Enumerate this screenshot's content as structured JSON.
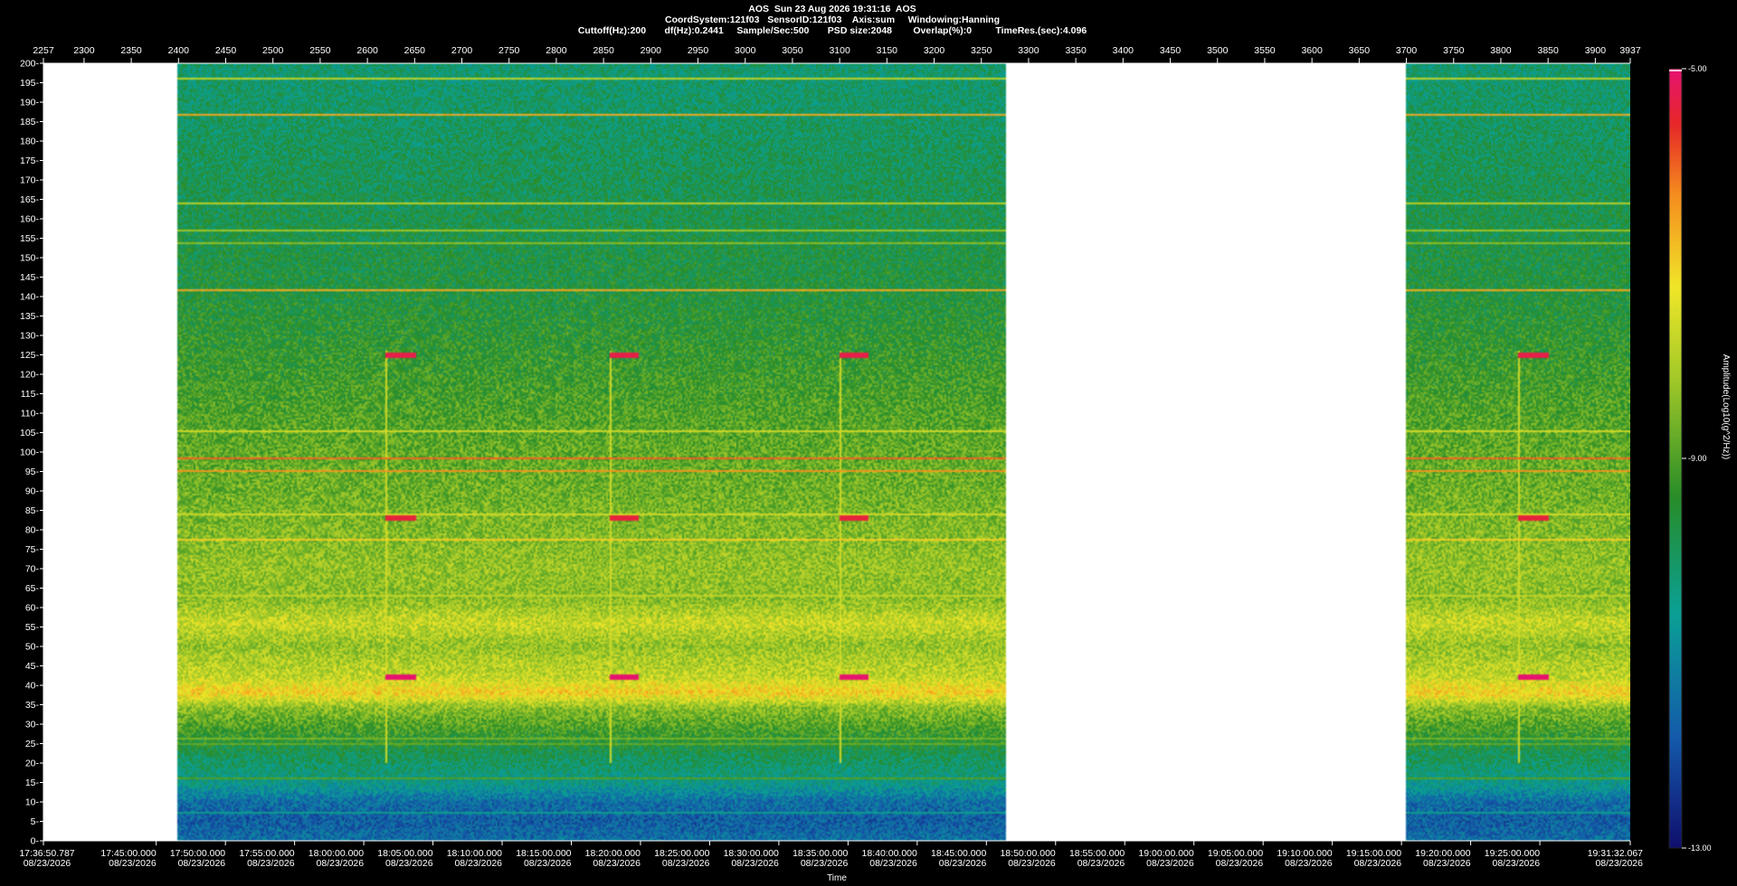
{
  "header": {
    "line1": "AOS  Sun 23 Aug 2026 19:31:16  AOS",
    "line2": "CoordSystem:121f03   SensorID:121f03    Axis:sum     Windowing:Hanning",
    "line3": "Cuttoff(Hz):200       df(Hz):0.2441     Sample/Sec:500       PSD size:2048        Overlap(%):0         TimeRes.(sec):4.096"
  },
  "chart_data": {
    "type": "heatmap",
    "title": "AOS  Sun 23 Aug 2026 19:31:16  AOS",
    "xlabel": "Time",
    "ylabel": "",
    "colorbar_label": "Amplitude(Log10(g^2/Hz))",
    "ylim": [
      0,
      200
    ],
    "y_ticks": [
      0,
      5,
      10,
      15,
      20,
      25,
      30,
      35,
      40,
      45,
      50,
      55,
      60,
      65,
      70,
      75,
      80,
      85,
      90,
      95,
      100,
      105,
      110,
      115,
      120,
      125,
      130,
      135,
      140,
      145,
      150,
      155,
      160,
      165,
      170,
      175,
      180,
      185,
      190,
      195,
      200
    ],
    "top_axis": {
      "range": [
        2257,
        3937
      ],
      "ticks": [
        2257,
        2300,
        2350,
        2400,
        2450,
        2500,
        2550,
        2600,
        2650,
        2700,
        2750,
        2800,
        2850,
        2900,
        2950,
        3000,
        3050,
        3100,
        3150,
        3200,
        3250,
        3300,
        3350,
        3400,
        3450,
        3500,
        3550,
        3600,
        3650,
        3700,
        3750,
        3800,
        3850,
        3900,
        3937
      ]
    },
    "time_axis": {
      "start": "17:36:50.787",
      "end": "19:31:32.067",
      "date": "08/23/2026",
      "start_seconds": 63410.787,
      "end_seconds": 70292.067,
      "ticks": [
        {
          "label": "17:36:50.787",
          "date": "08/23/2026",
          "seconds": 63410.787
        },
        {
          "label": "17:45:00.000",
          "date": "08/23/2026",
          "seconds": 63900
        },
        {
          "label": "17:50:00.000",
          "date": "08/23/2026",
          "seconds": 64200
        },
        {
          "label": "17:55:00.000",
          "date": "08/23/2026",
          "seconds": 64500
        },
        {
          "label": "18:00:00.000",
          "date": "08/23/2026",
          "seconds": 64800
        },
        {
          "label": "18:05:00.000",
          "date": "08/23/2026",
          "seconds": 65100
        },
        {
          "label": "18:10:00.000",
          "date": "08/23/2026",
          "seconds": 65400
        },
        {
          "label": "18:15:00.000",
          "date": "08/23/2026",
          "seconds": 65700
        },
        {
          "label": "18:20:00.000",
          "date": "08/23/2026",
          "seconds": 66000
        },
        {
          "label": "18:25:00.000",
          "date": "08/23/2026",
          "seconds": 66300
        },
        {
          "label": "18:30:00.000",
          "date": "08/23/2026",
          "seconds": 66600
        },
        {
          "label": "18:35:00.000",
          "date": "08/23/2026",
          "seconds": 66900
        },
        {
          "label": "18:40:00.000",
          "date": "08/23/2026",
          "seconds": 67200
        },
        {
          "label": "18:45:00.000",
          "date": "08/23/2026",
          "seconds": 67500
        },
        {
          "label": "18:50:00.000",
          "date": "08/23/2026",
          "seconds": 67800
        },
        {
          "label": "18:55:00.000",
          "date": "08/23/2026",
          "seconds": 68100
        },
        {
          "label": "19:00:00.000",
          "date": "08/23/2026",
          "seconds": 68400
        },
        {
          "label": "19:05:00.000",
          "date": "08/23/2026",
          "seconds": 68700
        },
        {
          "label": "19:10:00.000",
          "date": "08/23/2026",
          "seconds": 69000
        },
        {
          "label": "19:15:00.000",
          "date": "08/23/2026",
          "seconds": 69300
        },
        {
          "label": "19:20:00.000",
          "date": "08/23/2026",
          "seconds": 69600
        },
        {
          "label": "19:25:00.000",
          "date": "08/23/2026",
          "seconds": 69900
        },
        {
          "label": "19:31:32.067",
          "date": "08/23/2026",
          "seconds": 70292.067
        }
      ]
    },
    "data_segments": [
      {
        "start_top": 2400,
        "end_top": 3275
      },
      {
        "start_top": 3700,
        "end_top": 3937
      }
    ],
    "colorbar": {
      "min": -13.0,
      "max": -5.0,
      "mid": -9.0,
      "labels": [
        "-5.00",
        "-9.00",
        "-13.00"
      ]
    },
    "band_profile_hz": [
      {
        "hz": 0,
        "level": -11.5
      },
      {
        "hz": 5,
        "level": -11.8
      },
      {
        "hz": 10,
        "level": -11.5
      },
      {
        "hz": 14,
        "level": -10.6
      },
      {
        "hz": 18,
        "level": -10.2
      },
      {
        "hz": 22,
        "level": -9.9
      },
      {
        "hz": 26,
        "level": -9.4
      },
      {
        "hz": 30,
        "level": -8.9
      },
      {
        "hz": 34,
        "level": -8.4
      },
      {
        "hz": 38,
        "level": -7.0
      },
      {
        "hz": 42,
        "level": -7.8
      },
      {
        "hz": 46,
        "level": -8.0
      },
      {
        "hz": 50,
        "level": -8.3
      },
      {
        "hz": 56,
        "level": -7.7
      },
      {
        "hz": 62,
        "level": -8.4
      },
      {
        "hz": 70,
        "level": -8.3
      },
      {
        "hz": 80,
        "level": -8.5
      },
      {
        "hz": 90,
        "level": -8.7
      },
      {
        "hz": 100,
        "level": -8.8
      },
      {
        "hz": 110,
        "level": -9.0
      },
      {
        "hz": 120,
        "level": -9.2
      },
      {
        "hz": 130,
        "level": -9.4
      },
      {
        "hz": 140,
        "level": -9.6
      },
      {
        "hz": 150,
        "level": -9.7
      },
      {
        "hz": 160,
        "level": -9.8
      },
      {
        "hz": 170,
        "level": -9.9
      },
      {
        "hz": 180,
        "level": -10.0
      },
      {
        "hz": 190,
        "level": -10.1
      },
      {
        "hz": 200,
        "level": -10.2
      }
    ],
    "lines_hz": [
      {
        "hz": 196.5,
        "level": -7.8
      },
      {
        "hz": 186.8,
        "level": -6.6
      },
      {
        "hz": 164,
        "level": -7.9
      },
      {
        "hz": 157,
        "level": -8.2
      },
      {
        "hz": 154,
        "level": -8.4
      },
      {
        "hz": 141.5,
        "level": -6.6
      },
      {
        "hz": 105.5,
        "level": -7.6
      },
      {
        "hz": 98.2,
        "level": -6.0
      },
      {
        "hz": 95.3,
        "level": -6.4
      },
      {
        "hz": 84,
        "level": -7.6
      },
      {
        "hz": 77.5,
        "level": -7.0
      },
      {
        "hz": 63,
        "level": -7.8
      },
      {
        "hz": 26,
        "level": -8.6
      },
      {
        "hz": 24.5,
        "level": -8.8
      },
      {
        "hz": 16,
        "level": -9.0
      },
      {
        "hz": 7,
        "level": -10.5
      }
    ],
    "pulses": {
      "tops": [
        2620,
        2857,
        3100,
        3820
      ],
      "width": 30,
      "lines_hz": [
        {
          "hz": 124.8,
          "level": -5.3
        },
        {
          "hz": 83,
          "level": -5.4
        },
        {
          "hz": 42,
          "level": -5.0
        }
      ]
    }
  }
}
